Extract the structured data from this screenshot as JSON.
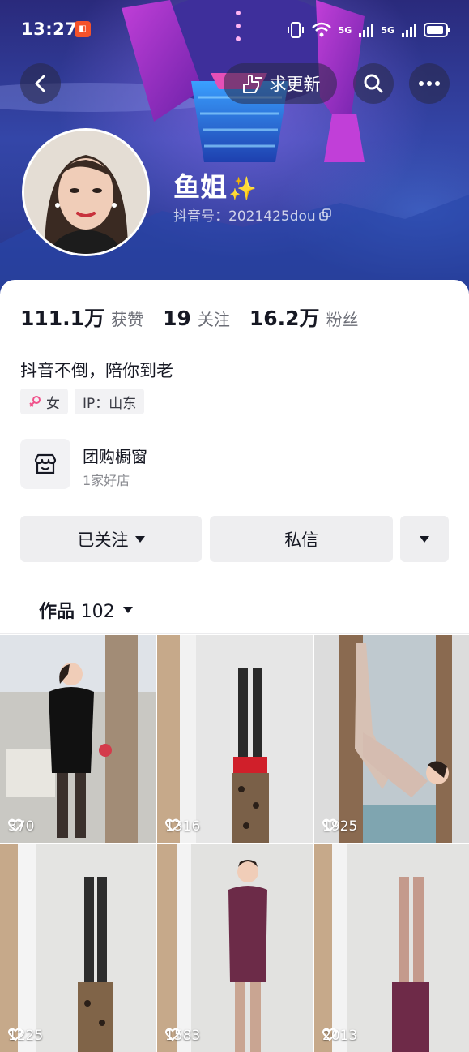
{
  "status_bar": {
    "time": "13:27",
    "network_a": "5G",
    "network_b": "5G"
  },
  "header": {
    "update_label": "求更新"
  },
  "profile": {
    "nickname": "鱼姐",
    "sparkle": "✨",
    "douyin_id": "抖音号：2021425dou",
    "stats": [
      {
        "value": "111.1万",
        "label": "获赞"
      },
      {
        "value": "19",
        "label": "关注"
      },
      {
        "value": "16.2万",
        "label": "粉丝"
      }
    ],
    "bio": "抖音不倒，陪你到老",
    "tags": {
      "gender": "女",
      "ip": "IP：山东"
    }
  },
  "shop": {
    "title": "团购橱窗",
    "subtitle": "1家好店"
  },
  "actions": {
    "followed_label": "已关注",
    "message_label": "私信"
  },
  "works_tab": {
    "label": "作品",
    "count": "102"
  },
  "videos": [
    {
      "likes": "370"
    },
    {
      "likes": "1316"
    },
    {
      "likes": "1925"
    },
    {
      "likes": "1225"
    },
    {
      "likes": "1583"
    },
    {
      "likes": "2013"
    }
  ],
  "colors": {
    "accent_female": "#f0528b",
    "cover_bg": "#2d3d9a"
  }
}
